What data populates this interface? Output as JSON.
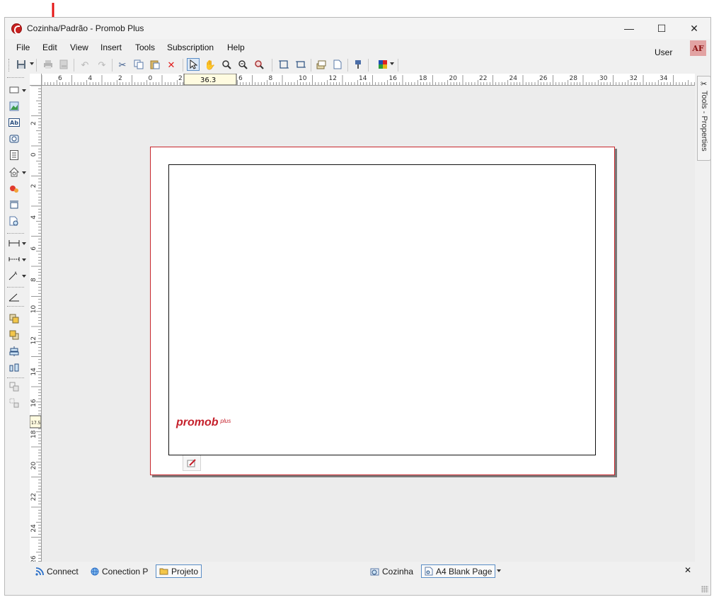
{
  "window": {
    "title": "Cozinha/Padrão - Promob Plus",
    "minimize_glyph": "—",
    "maximize_glyph": "☐",
    "close_glyph": "✕"
  },
  "menu": {
    "items": [
      "File",
      "Edit",
      "View",
      "Insert",
      "Tools",
      "Subscription",
      "Help"
    ],
    "user_label": "User",
    "user_badge": "AF"
  },
  "toolbar": {
    "icons": [
      "save-icon",
      "print-icon",
      "pdf-icon",
      "undo-icon",
      "redo-icon",
      "cut-icon",
      "copy-icon",
      "paste-icon",
      "delete-icon",
      "select-pointer-icon",
      "pan-hand-icon",
      "zoom-window-icon",
      "zoom-out-icon",
      "zoom-extents-icon",
      "frame-icon",
      "frame-alt-icon",
      "layers-icon",
      "page-icon",
      "properties-icon",
      "color-palette-icon"
    ],
    "disabled": [
      "print-icon",
      "pdf-icon",
      "undo-icon",
      "redo-icon"
    ]
  },
  "left_tools": {
    "icons": [
      "rectangle-icon",
      "image-icon",
      "text-icon",
      "camera-view-icon",
      "list-icon",
      "elevation-icon",
      "render-icon",
      "dimension-box-icon",
      "clock-doc-icon",
      "linear-dimension-icon",
      "aligned-dimension-icon",
      "label-icon",
      "angle-dimension-icon",
      "bring-front-icon",
      "send-back-icon",
      "align-center-icon",
      "distribute-icon",
      "group-icon",
      "ungroup-icon"
    ]
  },
  "ruler": {
    "horizontal_labels": [
      "6",
      "4",
      "2",
      "0",
      "2",
      "36.3",
      "4",
      "6",
      "8",
      "10",
      "12",
      "14",
      "16",
      "18",
      "20",
      "22",
      "24",
      "26",
      "28",
      "30",
      "32",
      "34"
    ],
    "vertical_labels": [
      "2",
      "0",
      "2",
      "4",
      "6",
      "8",
      "10",
      "12",
      "14",
      "16",
      "18",
      "20",
      "22",
      "24",
      "26"
    ],
    "horizontal_readout": "36.3",
    "vertical_readout": "17.5"
  },
  "canvas": {
    "logo_text": "promob",
    "logo_sub": "plus",
    "accent_color": "#c5202b"
  },
  "side_panel": {
    "label": "Tools - Properties"
  },
  "bottom_tabs": {
    "left": [
      {
        "label": "Connect",
        "icon": "rss-icon"
      },
      {
        "label": "Conection P",
        "icon": "globe-icon"
      },
      {
        "label": "Projeto",
        "icon": "folder-icon",
        "active": true
      }
    ],
    "right": [
      {
        "label": "Cozinha",
        "icon": "scene-icon"
      },
      {
        "label": "A4 Blank Page",
        "icon": "page-doc-icon",
        "active": true
      }
    ],
    "close_glyph": "✕"
  }
}
